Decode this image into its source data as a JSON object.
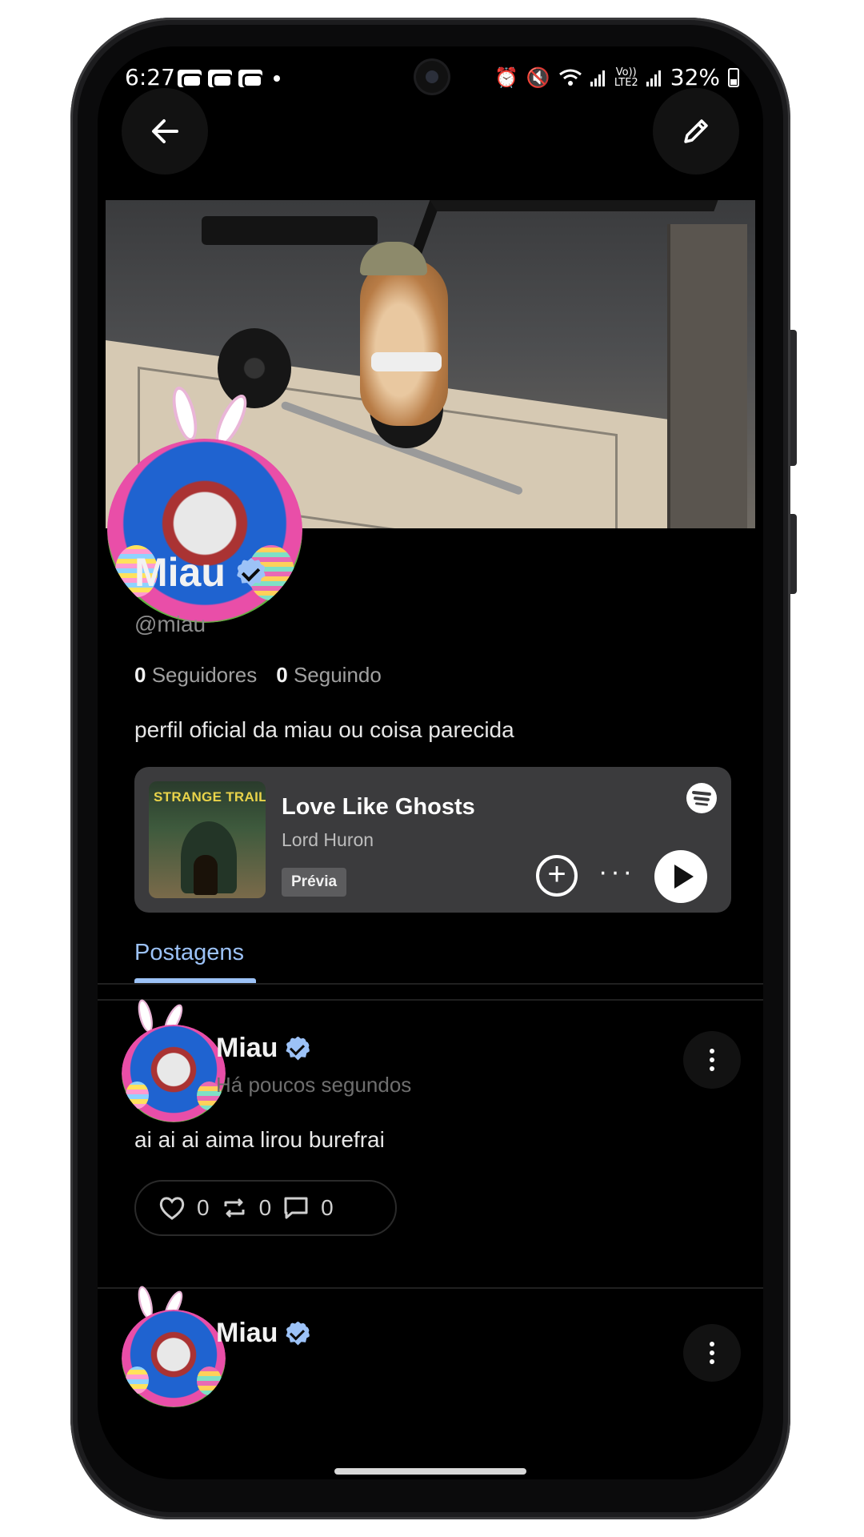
{
  "status_bar": {
    "time": "6:27",
    "volte": "Vo)) LTE2",
    "battery": "32%"
  },
  "header": {
    "back_icon": "arrow-left-icon",
    "edit_icon": "pencil-icon"
  },
  "profile": {
    "name": "Miau",
    "handle": "@miau",
    "followers_count": "0",
    "followers_label": "Seguidores",
    "following_count": "0",
    "following_label": "Seguindo",
    "bio": "perfil oficial da miau ou coisa parecida"
  },
  "spotify_embed": {
    "album_title": "STRANGE TRAILS",
    "song": "Love Like Ghosts",
    "artist": "Lord Huron",
    "preview_label": "Prévia",
    "add_symbol": "+",
    "more_symbol": "···"
  },
  "tabs": [
    {
      "label": "Postagens",
      "active": true
    }
  ],
  "posts": [
    {
      "author": "Miau",
      "time": "Há poucos segundos",
      "text": "ai ai ai aima lirou burefrai",
      "likes": "0",
      "reposts": "0",
      "comments": "0"
    },
    {
      "author": "Miau"
    }
  ],
  "colors": {
    "accent": "#9cc2f7",
    "background": "#000000",
    "card": "#3b3b3d"
  }
}
